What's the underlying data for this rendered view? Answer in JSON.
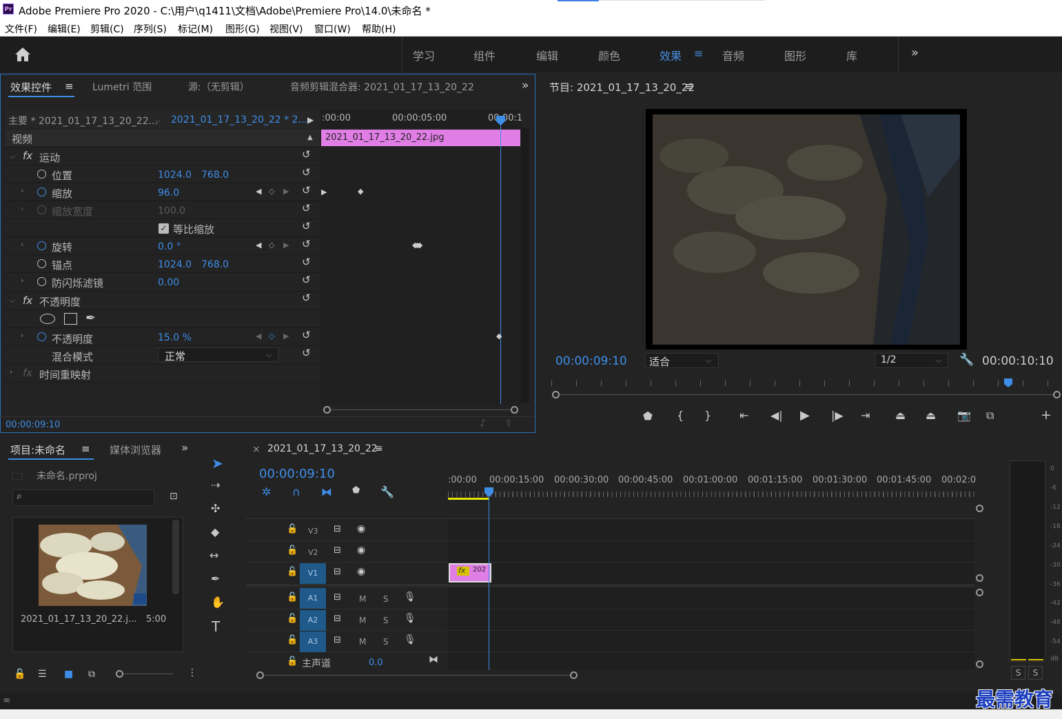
{
  "app": {
    "icon": "Pr",
    "title": "Adobe Premiere Pro 2020 - C:\\用户\\q1411\\文档\\Adobe\\Premiere Pro\\14.0\\未命名 *"
  },
  "menu": [
    "文件(F)",
    "编辑(E)",
    "剪辑(C)",
    "序列(S)",
    "标记(M)",
    "图形(G)",
    "视图(V)",
    "窗口(W)",
    "帮助(H)"
  ],
  "workspaces": [
    "学习",
    "组件",
    "编辑",
    "颜色",
    "效果",
    "音频",
    "图形",
    "库"
  ],
  "workspace_active": "效果",
  "overflow": "»",
  "effect_controls": {
    "tabs": [
      "效果控件",
      "Lumetri 范围",
      "源:（无剪辑）",
      "音频剪辑混合器: 2021_01_17_13_20_22"
    ],
    "menu_glyph": "≡",
    "master": "主要 * 2021_01_17_13_20_22...",
    "sequence": "2021_01_17_13_20_22 * 2...",
    "times": [
      ":00:00",
      "00:00:05:00",
      "00:00:1"
    ],
    "clip": "2021_01_17_13_20_22.jpg",
    "video_label": "视频",
    "motion": "运动",
    "position": {
      "label": "位置",
      "x": "1024.0",
      "y": "768.0"
    },
    "scale": {
      "label": "缩放",
      "value": "96.0"
    },
    "scale_width": {
      "label": "缩放宽度",
      "value": "100.0"
    },
    "uniform": "等比缩放",
    "rotation": {
      "label": "旋转",
      "value": "0.0 °"
    },
    "anchor": {
      "label": "锚点",
      "x": "1024.0",
      "y": "768.0"
    },
    "flicker": {
      "label": "防闪烁滤镜",
      "value": "0.00"
    },
    "opacity_section": "不透明度",
    "opacity": {
      "label": "不透明度",
      "value": "15.0 %"
    },
    "blend": {
      "label": "混合模式",
      "value": "正常"
    },
    "time_remap": "时间重映射",
    "current_time": "00:00:09:10"
  },
  "program": {
    "title": "节目: 2021_01_17_13_20_22",
    "timecode": "00:00:09:10",
    "fit": "适合",
    "resolution": "1/2",
    "duration": "00:00:10:10"
  },
  "project": {
    "tab": "项目:未命名",
    "tab2": "媒体浏览器",
    "file": "未命名.prproj",
    "clip_name": "2021_01_17_13_20_22.j...",
    "clip_dur": "5:00"
  },
  "timeline": {
    "close": "×",
    "title": "2021_01_17_13_20_22",
    "timecode": "00:00:09:10",
    "ruler": [
      ":00:00",
      "00:00:15:00",
      "00:00:30:00",
      "00:00:45:00",
      "00:01:00:00",
      "00:01:15:00",
      "00:01:30:00",
      "00:01:45:00",
      "00:02:0"
    ],
    "video_tracks": [
      "V3",
      "V2",
      "V1"
    ],
    "audio_tracks": [
      "A1",
      "A2",
      "A3"
    ],
    "mute": "M",
    "solo": "S",
    "clip_label": "202",
    "fx": "fx",
    "master": "主声道",
    "master_val": "0.0"
  },
  "meter": {
    "scale": [
      "0",
      "-6",
      "-12",
      "-18",
      "-24",
      "-30",
      "-36",
      "-42",
      "-48",
      "-54",
      "dB"
    ],
    "solo": [
      "S",
      "S"
    ]
  },
  "watermark": "最需教育"
}
